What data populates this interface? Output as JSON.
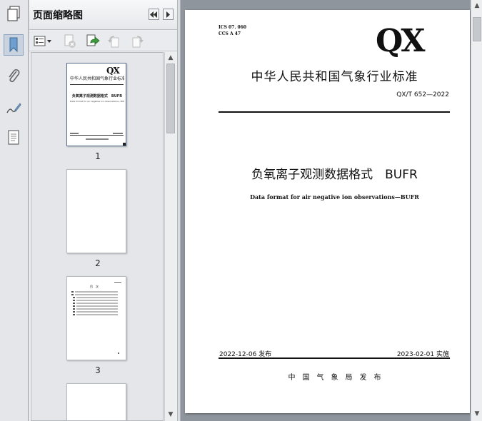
{
  "panel": {
    "title": "页面缩略图",
    "thumbnails": [
      {
        "label": "1"
      },
      {
        "label": "2"
      },
      {
        "label": "3"
      }
    ],
    "thumb1": {
      "logo": "QX",
      "title": "中华人民共和国气象行业标准",
      "doc_title": "负氧离子观测数据格式　BUFR",
      "subtitle_en": "Data format for air negative ion observations—BUFR"
    },
    "thumb3": {
      "heading": "目　次"
    }
  },
  "document": {
    "ics": "ICS 07. 060",
    "ccs": "CCS A 47",
    "logo": "QX",
    "standard_type": "中华人民共和国气象行业标准",
    "code": "QX/T 652—2022",
    "title_cn": "负氧离子观测数据格式　BUFR",
    "title_en": "Data format for air negative ion observations—BUFR",
    "release": "2022-12-06 发布",
    "implement": "2023-02-01 实施",
    "issuer": "中　国　气　象　局　发　布"
  },
  "icons": {
    "rail": [
      "pages-icon",
      "bookmark-icon",
      "attachment-icon",
      "signature-icon",
      "layers-icon"
    ],
    "toolbar": [
      "thumbnail-options-icon",
      "delete-page-icon",
      "extract-page-icon",
      "rotate-left-icon",
      "rotate-right-icon"
    ]
  }
}
